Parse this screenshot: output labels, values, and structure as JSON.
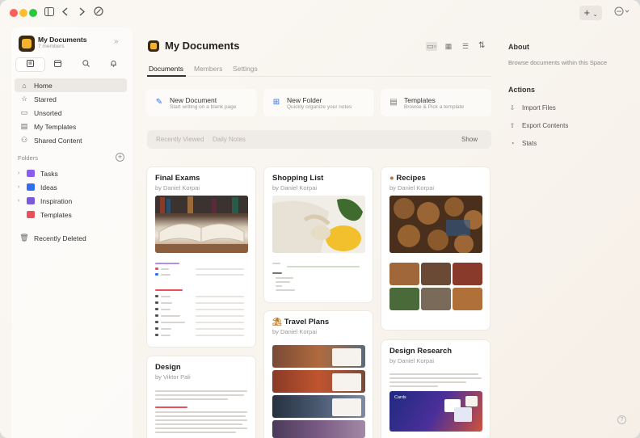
{
  "window": {
    "new_label": "+"
  },
  "space": {
    "name": "My Documents",
    "members": "7 members"
  },
  "sidebar": {
    "nav": [
      {
        "label": "Home",
        "icon": "house-icon"
      },
      {
        "label": "Starred",
        "icon": "star-icon"
      },
      {
        "label": "Unsorted",
        "icon": "tray-icon"
      },
      {
        "label": "My Templates",
        "icon": "template-icon"
      },
      {
        "label": "Shared Content",
        "icon": "people-icon"
      }
    ],
    "folders_title": "Folders",
    "folders": [
      {
        "label": "Tasks",
        "color": "#8a5cf0"
      },
      {
        "label": "Ideas",
        "color": "#2f6ff0"
      },
      {
        "label": "Inspiration",
        "color": "#7a5ad8"
      },
      {
        "label": "Templates",
        "color": "#e8505b"
      }
    ],
    "recently_deleted": "Recently Deleted"
  },
  "main": {
    "title": "My Documents",
    "tabs": [
      "Documents",
      "Members",
      "Settings"
    ],
    "actions": [
      {
        "title": "New Document",
        "subtitle": "Start writing on a blank page",
        "color": "#2f6ff0"
      },
      {
        "title": "New Folder",
        "subtitle": "Quickly organize your notes",
        "color": "#2f6ff0"
      },
      {
        "title": "Templates",
        "subtitle": "Browse & Pick a template",
        "color": "#777777"
      }
    ],
    "filters": [
      "Recently Viewed",
      "Daily Notes"
    ],
    "filter_show": "Show",
    "docs": [
      {
        "title": "Final Exams",
        "author": "by Daniel Korpai",
        "lines": [
          "Upcoming Exams",
          "Math",
          "Biology",
          "Additional Classes",
          "English",
          "Science",
          "History",
          "Computer Science",
          "Environmental Science",
          "Business"
        ]
      },
      {
        "title": "Shopping List",
        "author": "by Daniel Korpai",
        "lines": [
          "Food",
          "Drinks",
          "Orange Juice",
          "Apple Juice",
          "Milk",
          "Sparkling Water"
        ]
      },
      {
        "title": "Recipes",
        "author": "by Daniel Korpai"
      },
      {
        "title": "Travel Plans",
        "author": "by Daniel Korpai",
        "lines": [
          "Italy",
          "Spain",
          "United Kingdom",
          "France"
        ]
      },
      {
        "title": "Design",
        "author": "by Viktor Pali",
        "lines": [
          "Design as a practice"
        ]
      },
      {
        "title": "Design Research",
        "author": "by Daniel Korpai",
        "lines": [
          "Cards"
        ]
      }
    ]
  },
  "panel": {
    "about_title": "About",
    "about_text": "Browse documents within this Space",
    "actions_title": "Actions",
    "actions": [
      "Import Files",
      "Export Contents",
      "Stats"
    ]
  },
  "help": "?"
}
